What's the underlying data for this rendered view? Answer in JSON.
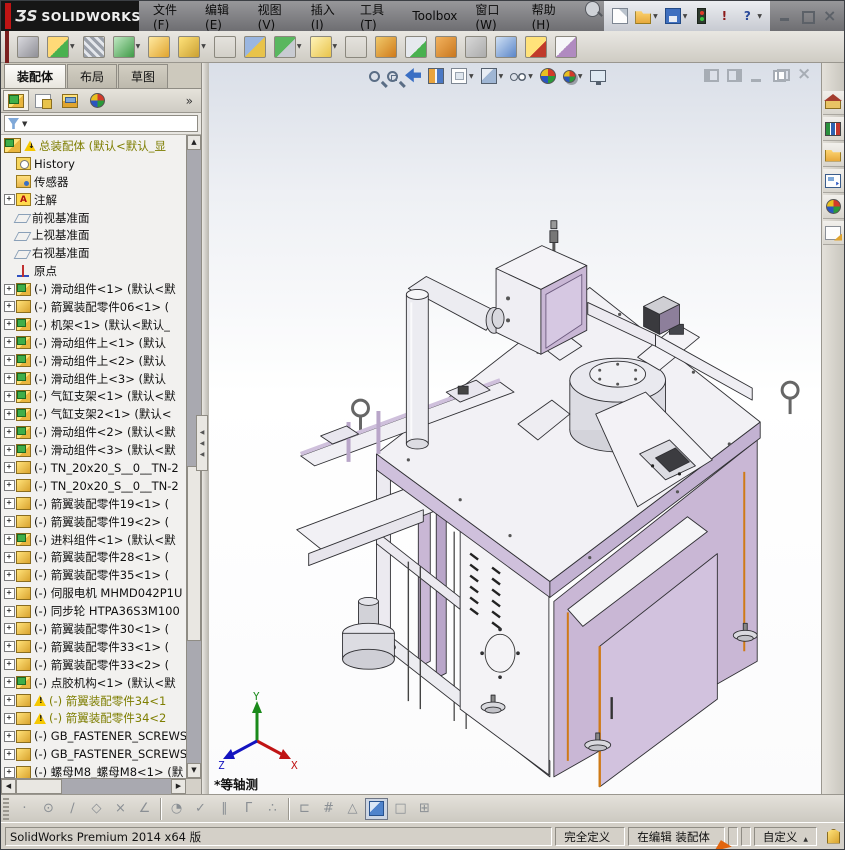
{
  "titlebar": {
    "brand_mark": "ƷS",
    "brand": "SOLIDWORKS",
    "menus": [
      {
        "label": "文件(F)"
      },
      {
        "label": "编辑(E)"
      },
      {
        "label": "视图(V)"
      },
      {
        "label": "插入(I)"
      },
      {
        "label": "工具(T)"
      },
      {
        "label": "Toolbox"
      },
      {
        "label": "窗口(W)"
      },
      {
        "label": "帮助(H)"
      }
    ],
    "quick_icons": [
      {
        "name": "new-document-icon",
        "cls": "qi-new",
        "dd": false
      },
      {
        "name": "open-icon",
        "cls": "qi-open",
        "dd": true
      },
      {
        "name": "save-icon",
        "cls": "qi-save",
        "dd": true
      },
      {
        "name": "rebuild-traffic-light-icon",
        "cls": "qi-light",
        "dd": false
      },
      {
        "name": "interrupt-icon",
        "cls": "qi-excl",
        "glyph": "!",
        "dd": false
      },
      {
        "name": "help-icon",
        "cls": "qi-help",
        "glyph": "?",
        "dd": true
      }
    ]
  },
  "assembly_toolbar": {
    "buttons": [
      {
        "name": "insert-component-icon",
        "cls": "g1",
        "dd": false
      },
      {
        "name": "insert-from-file-icon",
        "cls": "g2",
        "dd": true
      },
      {
        "name": "mate-icon",
        "cls": "g3",
        "dd": false
      },
      {
        "name": "linear-component-pattern-icon",
        "cls": "g4",
        "dd": true
      },
      {
        "name": "smart-fasteners-icon",
        "cls": "g5",
        "dd": false
      },
      {
        "name": "move-component-icon",
        "cls": "g6",
        "dd": true
      },
      {
        "name": "sep",
        "cls": "sep",
        "dd": false
      },
      {
        "name": "show-hidden-components-icon",
        "cls": "g7",
        "dd": false
      },
      {
        "name": "assembly-features-icon",
        "cls": "g8",
        "dd": true
      },
      {
        "name": "reference-geometry-icon",
        "cls": "g9",
        "dd": true
      },
      {
        "name": "sep",
        "cls": "sep",
        "dd": false
      },
      {
        "name": "new-motion-study-icon",
        "cls": "g10",
        "dd": false
      },
      {
        "name": "bill-of-materials-icon",
        "cls": "g11",
        "dd": false
      },
      {
        "name": "exploded-view-icon",
        "cls": "g12",
        "dd": false
      },
      {
        "name": "explode-line-sketch-icon",
        "cls": "g13",
        "dd": false
      },
      {
        "name": "interference-detection-icon",
        "cls": "g14",
        "dd": false
      },
      {
        "name": "isolate-icon",
        "cls": "g15",
        "dd": false
      },
      {
        "name": "take-snapshot-icon",
        "cls": "g16",
        "dd": false
      }
    ]
  },
  "command_tabs": {
    "items": [
      {
        "label": "装配体",
        "state": "active"
      },
      {
        "label": "布局",
        "state": ""
      },
      {
        "label": "草图",
        "state": ""
      }
    ]
  },
  "panel_tabs": {
    "items": [
      {
        "name": "featuremanager-tree-tab",
        "cls": "pt-feat",
        "state": "active"
      },
      {
        "name": "propertymanager-tab",
        "cls": "pt-prop",
        "state": ""
      },
      {
        "name": "configurationmanager-tab",
        "cls": "pt-cfg",
        "state": ""
      },
      {
        "name": "displaymanager-tab",
        "cls": "pt-disp",
        "state": ""
      }
    ],
    "overflow_chevron": "»"
  },
  "filter": {
    "caret": "▼"
  },
  "tree": {
    "items": [
      {
        "label": "总装配体  (默认<默认_显",
        "icon": "i-asm big",
        "warn": "w-down",
        "exp": "rootslot",
        "cls": "olive"
      },
      {
        "label": "History",
        "icon": "i-hist",
        "warn": "none",
        "exp": "",
        "cls": ""
      },
      {
        "label": "传感器",
        "icon": "i-sens",
        "warn": "none",
        "exp": "",
        "cls": ""
      },
      {
        "label": "注解",
        "icon": "i-ann",
        "warn": "none",
        "exp": "plus",
        "cls": ""
      },
      {
        "label": "前视基准面",
        "icon": "i-plane",
        "warn": "none",
        "exp": "",
        "cls": ""
      },
      {
        "label": "上视基准面",
        "icon": "i-plane",
        "warn": "none",
        "exp": "",
        "cls": ""
      },
      {
        "label": "右视基准面",
        "icon": "i-plane",
        "warn": "none",
        "exp": "",
        "cls": ""
      },
      {
        "label": "原点",
        "icon": "i-origin",
        "warn": "none",
        "exp": "",
        "cls": ""
      },
      {
        "label": "(-) 滑动组件<1> (默认<默",
        "icon": "i-asm",
        "warn": "none",
        "exp": "plus",
        "cls": ""
      },
      {
        "label": "(-) 箭翼装配零件06<1> (",
        "icon": "i-part",
        "warn": "none",
        "exp": "plus",
        "cls": ""
      },
      {
        "label": "(-) 机架<1> (默认<默认_",
        "icon": "i-asm",
        "warn": "none",
        "exp": "plus",
        "cls": ""
      },
      {
        "label": "(-) 滑动组件上<1> (默认",
        "icon": "i-asm",
        "warn": "none",
        "exp": "plus",
        "cls": ""
      },
      {
        "label": "(-) 滑动组件上<2> (默认",
        "icon": "i-asm",
        "warn": "none",
        "exp": "plus",
        "cls": ""
      },
      {
        "label": "(-) 滑动组件上<3> (默认",
        "icon": "i-asm",
        "warn": "none",
        "exp": "plus",
        "cls": ""
      },
      {
        "label": "(-) 气缸支架<1> (默认<默",
        "icon": "i-asm",
        "warn": "none",
        "exp": "plus",
        "cls": ""
      },
      {
        "label": "(-) 气缸支架2<1> (默认<",
        "icon": "i-asm",
        "warn": "none",
        "exp": "plus",
        "cls": ""
      },
      {
        "label": "(-) 滑动组件<2> (默认<默",
        "icon": "i-asm",
        "warn": "none",
        "exp": "plus",
        "cls": ""
      },
      {
        "label": "(-) 滑动组件<3> (默认<默",
        "icon": "i-asm",
        "warn": "none",
        "exp": "plus",
        "cls": ""
      },
      {
        "label": "(-) TN_20x20_S__0__TN-2",
        "icon": "i-part",
        "warn": "none",
        "exp": "plus",
        "cls": ""
      },
      {
        "label": "(-) TN_20x20_S__0__TN-2",
        "icon": "i-part",
        "warn": "none",
        "exp": "plus",
        "cls": ""
      },
      {
        "label": "(-) 箭翼装配零件19<1> (",
        "icon": "i-part",
        "warn": "none",
        "exp": "plus",
        "cls": ""
      },
      {
        "label": "(-) 箭翼装配零件19<2> (",
        "icon": "i-part",
        "warn": "none",
        "exp": "plus",
        "cls": ""
      },
      {
        "label": "(-) 进料组件<1> (默认<默",
        "icon": "i-asm",
        "warn": "none",
        "exp": "plus",
        "cls": ""
      },
      {
        "label": "(-) 箭翼装配零件28<1> (",
        "icon": "i-part",
        "warn": "none",
        "exp": "plus",
        "cls": ""
      },
      {
        "label": "(-) 箭翼装配零件35<1> (",
        "icon": "i-part",
        "warn": "none",
        "exp": "plus",
        "cls": ""
      },
      {
        "label": "(-) 伺服电机 MHMD042P1U",
        "icon": "i-part",
        "warn": "none",
        "exp": "plus",
        "cls": ""
      },
      {
        "label": "(-) 同步轮 HTPA36S3M100",
        "icon": "i-part",
        "warn": "none",
        "exp": "plus",
        "cls": ""
      },
      {
        "label": "(-) 箭翼装配零件30<1> (",
        "icon": "i-part",
        "warn": "none",
        "exp": "plus",
        "cls": ""
      },
      {
        "label": "(-) 箭翼装配零件33<1> (",
        "icon": "i-part",
        "warn": "none",
        "exp": "plus",
        "cls": ""
      },
      {
        "label": "(-) 箭翼装配零件33<2> (",
        "icon": "i-part",
        "warn": "none",
        "exp": "plus",
        "cls": ""
      },
      {
        "label": "(-) 点胶机构<1> (默认<默",
        "icon": "i-asm",
        "warn": "none",
        "exp": "plus",
        "cls": ""
      },
      {
        "label": "(-) 箭翼装配零件34<1",
        "icon": "i-part",
        "warn": "w-tri",
        "exp": "plus",
        "cls": "olive"
      },
      {
        "label": "(-) 箭翼装配零件34<2",
        "icon": "i-part",
        "warn": "w-tri",
        "exp": "plus",
        "cls": "olive"
      },
      {
        "label": "(-) GB_FASTENER_SCREWS_",
        "icon": "i-part",
        "warn": "none",
        "exp": "plus",
        "cls": ""
      },
      {
        "label": "(-) GB_FASTENER_SCREWS_",
        "icon": "i-part",
        "warn": "none",
        "exp": "plus",
        "cls": ""
      },
      {
        "label": "(-) 螺母M8_螺母M8<1> (默",
        "icon": "i-part",
        "warn": "none",
        "exp": "plus",
        "cls": ""
      }
    ]
  },
  "viewport": {
    "view_label": "*等轴测",
    "triad": {
      "x": "X",
      "y": "Y",
      "z": "Z"
    },
    "headsup_icons": [
      "zoom-to-fit-icon",
      "zoom-to-area-icon",
      "previous-view-icon",
      "section-view-icon",
      "view-orientation-icon",
      "display-style-icon",
      "hide-show-items-icon",
      "edit-appearance-icon",
      "apply-scene-icon",
      "view-settings-icon"
    ],
    "doc_controls": [
      "collapse-left-pane-icon",
      "collapse-right-pane-icon",
      "doc-minimize-icon",
      "doc-restore-icon",
      "doc-close-icon"
    ]
  },
  "taskpane": {
    "icons": [
      {
        "name": "solidworks-resources-icon",
        "cls": "tp-home"
      },
      {
        "name": "design-library-icon",
        "cls": "tp-lib"
      },
      {
        "name": "file-explorer-icon",
        "cls": "tp-folder"
      },
      {
        "name": "view-palette-icon",
        "cls": "tp-palette"
      },
      {
        "name": "appearances-scenes-icon",
        "cls": "tp-ball"
      },
      {
        "name": "custom-properties-icon",
        "cls": "tp-props"
      }
    ]
  },
  "sketch_snap_toolbar": {
    "glyphs": [
      {
        "g": "·",
        "cls": ""
      },
      {
        "g": "⊙",
        "cls": ""
      },
      {
        "g": "∕",
        "cls": ""
      },
      {
        "g": "◇",
        "cls": ""
      },
      {
        "g": "×",
        "cls": ""
      },
      {
        "g": "∠",
        "cls": ""
      },
      {
        "g": "",
        "cls": "sep"
      },
      {
        "g": "◔",
        "cls": ""
      },
      {
        "g": "✓",
        "cls": ""
      },
      {
        "g": "∥",
        "cls": ""
      },
      {
        "g": "Γ",
        "cls": ""
      },
      {
        "g": "∴",
        "cls": ""
      },
      {
        "g": "",
        "cls": "sep"
      },
      {
        "g": "⊏",
        "cls": ""
      },
      {
        "g": "#",
        "cls": ""
      },
      {
        "g": "△",
        "cls": ""
      },
      {
        "g": "",
        "cls": "g-cube"
      },
      {
        "g": "□",
        "cls": ""
      },
      {
        "g": "⊞",
        "cls": ""
      }
    ]
  },
  "statusbar": {
    "left": "SolidWorks Premium 2014 x64 版",
    "cells": [
      {
        "label": "完全定义",
        "cls": "",
        "caret": ""
      },
      {
        "label": "在编辑 装配体",
        "cls": "",
        "caret": ""
      },
      {
        "label": "",
        "cls": "empty",
        "caret": ""
      },
      {
        "label": "",
        "cls": "empty",
        "caret": ""
      },
      {
        "label": "自定义",
        "cls": "",
        "caret": "▲"
      }
    ]
  },
  "colors": {
    "panel_lavender": "#cbb9d6",
    "door_trim_orange": "#cf7a16",
    "warn_olive": "#7e7e00",
    "accent_blue": "#3a6fc4"
  }
}
